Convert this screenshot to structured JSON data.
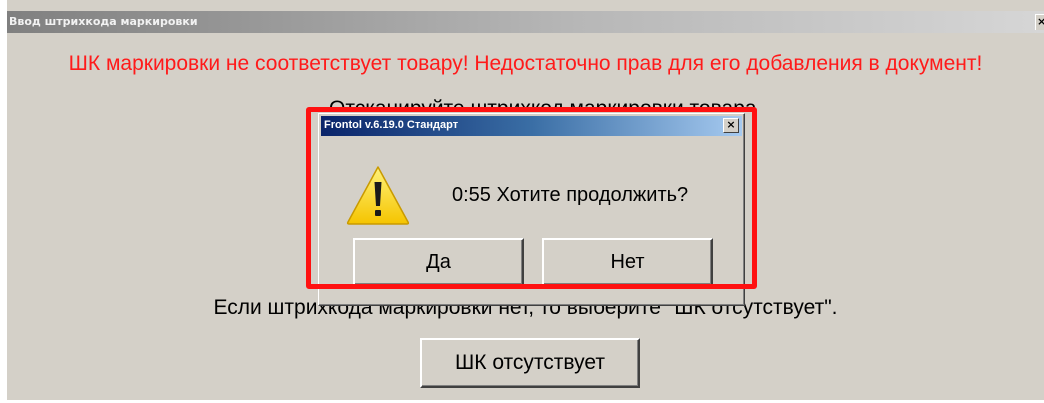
{
  "main_window": {
    "title": "Ввод штрихкода маркировки",
    "close_glyph": "×",
    "error_message": "ШК маркировки не соответствует товару! Недостаточно прав для его добавления в документ!",
    "scan_prompt": "Отсканируйте штрихкод маркировки товара",
    "hint": "Если штрихкода маркировки нет, то выберите \"ШК отсутствует\".",
    "absent_button": "ШК отсутствует"
  },
  "dialog": {
    "title": "Frontol v.6.19.0 Стандарт",
    "close_glyph": "×",
    "icon": "warning-icon",
    "message": "0:55  Хотите продолжить?",
    "yes_button": "Да",
    "no_button": "Нет"
  },
  "colors": {
    "error_text": "#ff1a1a",
    "highlight_frame": "#ff1111",
    "window_bg": "#d4d0c8",
    "dialog_title_start": "#0a246a",
    "warning_yellow": "#ffd800"
  }
}
